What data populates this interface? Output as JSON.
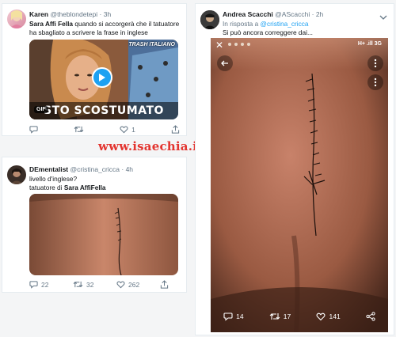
{
  "colors": {
    "accent": "#1da1f2",
    "muted": "#657786",
    "watermark": "#e3342f"
  },
  "watermark": "www.isaechia.it",
  "tweets": {
    "karen": {
      "name": "Karen",
      "handle": "@theblondetepi",
      "sep": "·",
      "time": "3h",
      "text_bold": "Sara Affi Fella",
      "text_rest": " quando si accorgerà che il tatuatore ha sbagliato a scrivere la frase in inglese",
      "media": {
        "badge": "GIF",
        "caption": "STO SCOSTUMATO",
        "logo": "TRASH ITALIANO"
      },
      "likes": "1"
    },
    "dementalist": {
      "name": "DEmentalist",
      "handle": "@cristina_cricca",
      "sep": "·",
      "time": "4h",
      "line1": "livello d'inglese?",
      "line2_prefix": "tatuatore di ",
      "line2_bold": "Sara AffiFella",
      "replies": "22",
      "retweets": "32",
      "likes": "262"
    },
    "andrea": {
      "name": "Andrea Scacchi",
      "handle": "@AScacchi",
      "sep": "·",
      "time": "2h",
      "reply_prefix": "In risposta a ",
      "reply_mention": "@cristina_cricca",
      "text": "Si può ancora correggere dai...",
      "phone": {
        "status": "H+ .ill 3G",
        "replies": "14",
        "retweets": "17",
        "likes": "141"
      }
    }
  }
}
